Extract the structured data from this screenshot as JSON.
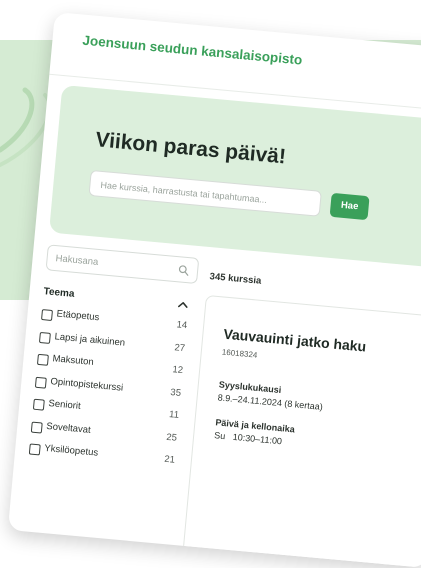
{
  "brand": {
    "name": "Joensuun seudun kansalaisopisto"
  },
  "hero": {
    "title": "Viikon paras päivä!",
    "search_placeholder": "Hae kurssia, harrastusta tai tapahtumaa...",
    "search_button": "Hae"
  },
  "sidebar": {
    "keyword_placeholder": "Hakusana",
    "filter_title": "Teema",
    "items": [
      {
        "label": "Etäopetus",
        "count": "14"
      },
      {
        "label": "Lapsi ja aikuinen",
        "count": "27"
      },
      {
        "label": "Maksuton",
        "count": "12"
      },
      {
        "label": "Opintopistekurssi",
        "count": "35"
      },
      {
        "label": "Seniorit",
        "count": "11"
      },
      {
        "label": "Soveltavat",
        "count": "25"
      },
      {
        "label": "Yksilöopetus",
        "count": "21"
      }
    ]
  },
  "results": {
    "count_text": "345 kurssia",
    "first": {
      "title": "Vauvauinti jatko haku",
      "code": "16018324",
      "term_label": "Syyslukukausi",
      "term_value": "8.9.–24.11.2024 (8 kertaa)",
      "time_label": "Päivä ja kellonaika",
      "time_day": "Su",
      "time_value": "10:30–11:00"
    }
  },
  "colors": {
    "accent": "#3aa05a",
    "hero_bg": "#dcefdc",
    "page_band": "#d5ebd3"
  }
}
